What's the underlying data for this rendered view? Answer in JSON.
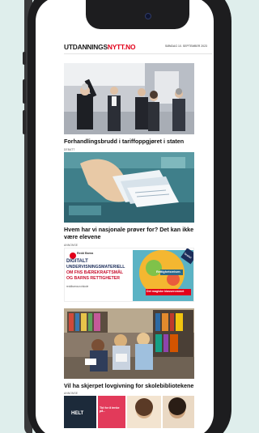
{
  "site": {
    "logo_main": "UTDANNINGS",
    "logo_accent": "NYTT.NO",
    "dateline": "SØNDAG 10. SEPTEMBER 2023"
  },
  "articles": [
    {
      "headline": "Forhandlingsbrudd i tariffoppgjøret i staten",
      "image": "photo-people-press-event"
    },
    {
      "kicker": "DEBATT",
      "headline": "Hvem har vi nasjonale prøver for? Det kan ikke være elevene",
      "image": "illustration-hand-with-papers"
    },
    {
      "headline": "Vil ha skjerpet lovgivning for skolebibliotekene",
      "image": "photo-children-reading-library"
    },
    {
      "kicker": "ANNONSE",
      "image": "promo-banner-bottom",
      "teaser_texts": [
        "HELT",
        "Tid for å tenke på..."
      ]
    }
  ],
  "ad": {
    "kicker": "ANNONSE",
    "brand": "Redd Barna",
    "lines": [
      "DIGITALT",
      "UNDERVISNINGSMATERIELL",
      "OM FNS BÆREKRAFTSMÅL",
      "OG BARNS RETTIGHETER"
    ],
    "url": "reddbarna.no/skole",
    "ribbon": "Gratis!",
    "badge": "Rettighetsreisen",
    "cta": "Det magiske klasserommet"
  },
  "colors": {
    "accent": "#e2001a",
    "background": "#dfeeec",
    "ad_red": "#c8102e"
  }
}
